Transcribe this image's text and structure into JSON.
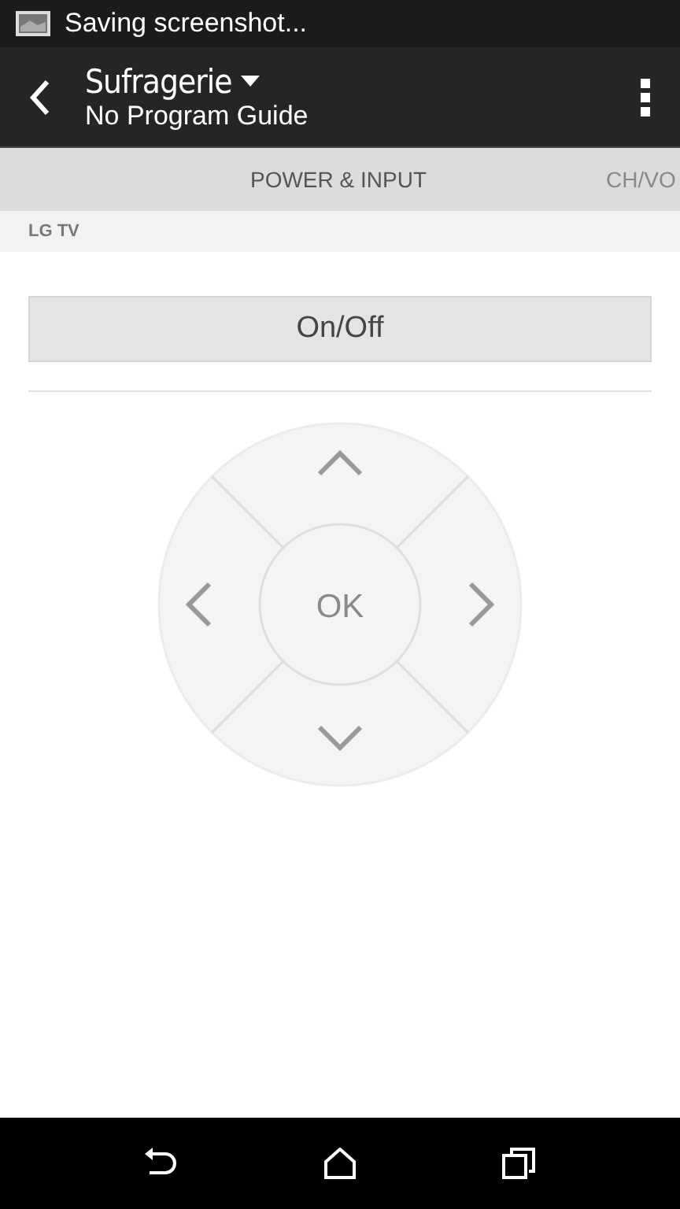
{
  "status_bar": {
    "notification": "Saving screenshot..."
  },
  "action_bar": {
    "title": "Sufragerie",
    "subtitle": "No Program Guide"
  },
  "tabs": [
    {
      "label": "POWER & INPUT",
      "selected": true
    },
    {
      "label": "CH/VO",
      "selected": false
    }
  ],
  "section": {
    "title": "LG TV"
  },
  "power_button": {
    "label": "On/Off"
  },
  "dpad": {
    "center_label": "OK"
  }
}
